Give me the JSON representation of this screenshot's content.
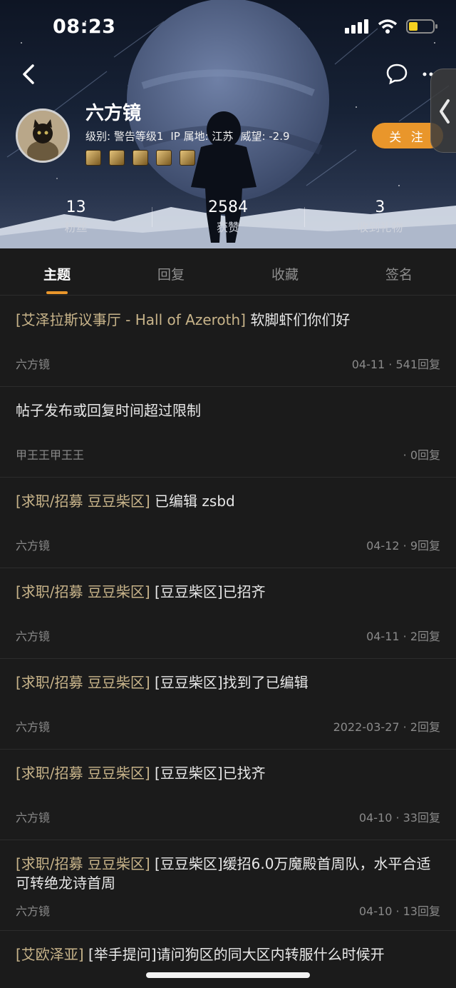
{
  "status_bar": {
    "time": "08:23"
  },
  "profile": {
    "username": "六方镜",
    "level_label": "级别: 警告等级1",
    "ip_label": "IP 属地: 江苏",
    "prestige_label": "威望: -2.9",
    "follow_label": "关 注",
    "badge_count": 5
  },
  "stats": [
    {
      "value": "13",
      "label": "粉丝"
    },
    {
      "value": "2584",
      "label": "获赞"
    },
    {
      "value": "3",
      "label": "收到礼物"
    }
  ],
  "tabs": [
    {
      "label": "主题",
      "active": true
    },
    {
      "label": "回复",
      "active": false
    },
    {
      "label": "收藏",
      "active": false
    },
    {
      "label": "签名",
      "active": false
    }
  ],
  "posts": [
    {
      "tag": "[艾泽拉斯议事厅 - Hall of Azeroth]",
      "title": " 软脚虾们你们好",
      "author": "六方镜",
      "meta": "04-11 · 541回复"
    },
    {
      "tag": "",
      "title": "帖子发布或回复时间超过限制",
      "author": "甲王王甲王王",
      "meta": "· 0回复"
    },
    {
      "tag": "[求职/招募 豆豆柴区]",
      "title": " 已编辑 zsbd",
      "author": "六方镜",
      "meta": "04-12 · 9回复"
    },
    {
      "tag": "[求职/招募 豆豆柴区]",
      "title": " [豆豆柴区]已招齐",
      "author": "六方镜",
      "meta": "04-11 · 2回复"
    },
    {
      "tag": "[求职/招募 豆豆柴区]",
      "title": " [豆豆柴区]找到了已编辑",
      "author": "六方镜",
      "meta": "2022-03-27 · 2回复"
    },
    {
      "tag": "[求职/招募 豆豆柴区]",
      "title": " [豆豆柴区]已找齐",
      "author": "六方镜",
      "meta": "04-10 · 33回复"
    },
    {
      "tag": "[求职/招募 豆豆柴区]",
      "title": " [豆豆柴区]缓招6.0万魔殿首周队，水平合适可转绝龙诗首周",
      "author": "六方镜",
      "meta": "04-10 · 13回复"
    },
    {
      "tag": "[艾欧泽亚]",
      "title": " [举手提问]请问狗区的同大区内转服什么时候开",
      "author": "",
      "meta": ""
    }
  ],
  "colors": {
    "accent": "#e9962b",
    "tag": "#c8b48a",
    "background": "#1b1b1b"
  },
  "icons": {
    "back": "chevron-left-icon",
    "chat": "chat-bubble-icon",
    "more": "more-dots-icon",
    "handle": "chevron-left-icon"
  }
}
